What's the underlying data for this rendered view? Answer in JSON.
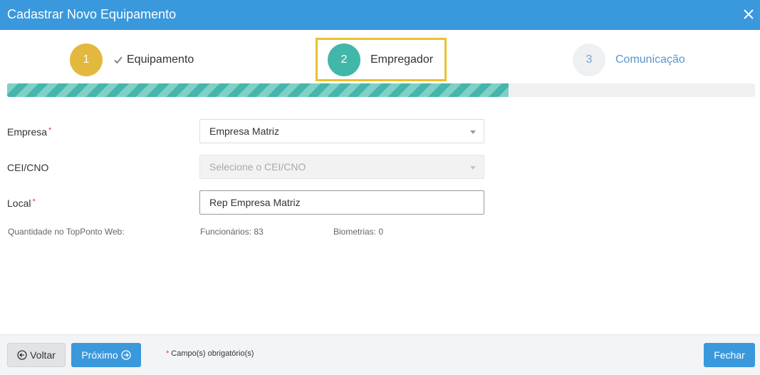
{
  "header": {
    "title": "Cadastrar Novo Equipamento",
    "close_icon": "close-icon"
  },
  "wizard": {
    "steps": [
      {
        "number": "1",
        "label": "Equipamento",
        "status": "completed",
        "icon": "check-icon"
      },
      {
        "number": "2",
        "label": "Empregador",
        "status": "active"
      },
      {
        "number": "3",
        "label": "Comunicação",
        "status": "pending"
      }
    ],
    "progress_fraction": 0.67
  },
  "form": {
    "empresa": {
      "label": "Empresa",
      "value": "Empresa Matriz"
    },
    "cei": {
      "label": "CEI/CNO",
      "placeholder": "Selecione o CEI/CNO"
    },
    "local": {
      "label": "Local",
      "value": "Rep Empresa Matriz"
    },
    "required_marker": "*"
  },
  "quantities": {
    "label": "Quantidade no TopPonto Web:",
    "funcionarios": "Funcionários: 83",
    "biometrias": "Biometrias: 0"
  },
  "footer": {
    "voltar_label": "Voltar",
    "proximo_label": "Próximo",
    "required_note": "Campo(s) obrigatório(s)",
    "fechar_label": "Fechar"
  },
  "colors": {
    "primary": "#3a98dc",
    "step_done": "#e2b93e",
    "step_active": "#41b7a9",
    "highlight": "#e8c22f",
    "required": "#e23b3b"
  }
}
